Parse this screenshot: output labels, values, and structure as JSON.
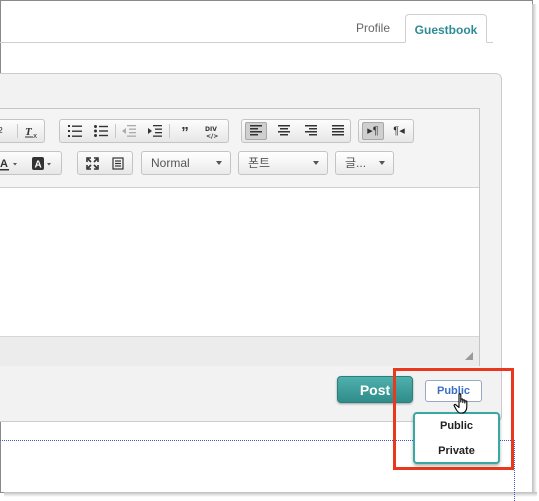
{
  "tabs": {
    "profile": "Profile",
    "guestbook": "Guestbook"
  },
  "toolbar": {
    "row1": [
      "superscript-icon",
      "remove-format-icon",
      "numbered-list-icon",
      "bulleted-list-icon",
      "outdent-icon",
      "indent-icon",
      "blockquote-icon",
      "div-container-icon",
      "align-left-icon",
      "align-center-icon",
      "align-right-icon",
      "justify-icon",
      "ltr-icon",
      "rtl-icon"
    ],
    "row2_buttons": [
      "text-color-icon",
      "background-color-icon",
      "maximize-icon",
      "show-blocks-icon"
    ],
    "format_combo": "Normal",
    "font_combo": "폰트",
    "size_combo": "글..."
  },
  "post_button": "Post",
  "visibility": {
    "current": "Public",
    "options": [
      "Public",
      "Private"
    ]
  },
  "colors": {
    "accent": "#2e8b95",
    "post_button": "#3a9b98",
    "highlight": "#e8391f",
    "dropdown_border": "#38a8a3"
  }
}
